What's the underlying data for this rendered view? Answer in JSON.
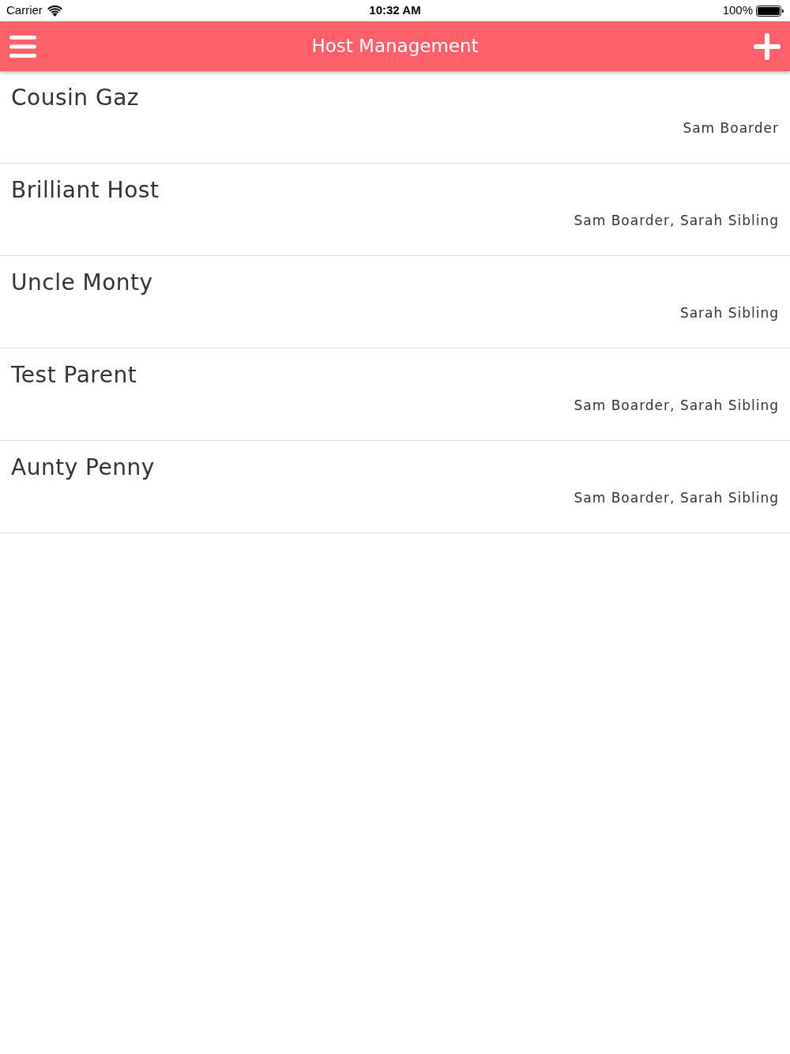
{
  "status_bar": {
    "carrier": "Carrier",
    "time": "10:32 AM",
    "battery": "100%"
  },
  "header": {
    "title": "Host Management"
  },
  "hosts": [
    {
      "name": "Cousin Gaz",
      "members": "Sam Boarder"
    },
    {
      "name": "Brilliant Host",
      "members": "Sam Boarder, Sarah Sibling"
    },
    {
      "name": "Uncle Monty",
      "members": "Sarah Sibling"
    },
    {
      "name": "Test Parent",
      "members": "Sam Boarder, Sarah Sibling"
    },
    {
      "name": "Aunty Penny",
      "members": "Sam Boarder, Sarah Sibling"
    }
  ]
}
